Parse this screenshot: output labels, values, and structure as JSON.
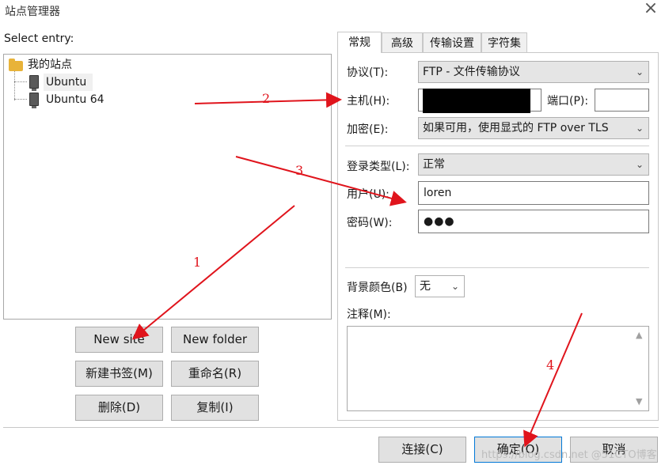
{
  "window": {
    "title": "站点管理器",
    "close_symbol": "×"
  },
  "left": {
    "select_entry_label": "Select entry:",
    "tree": {
      "root": "我的站点",
      "items": [
        "Ubuntu",
        "Ubuntu 64"
      ]
    },
    "buttons": {
      "new_site": "New site",
      "new_folder": "New folder",
      "new_bookmark": "新建书签(M)",
      "rename": "重命名(R)",
      "delete": "删除(D)",
      "copy": "复制(I)"
    }
  },
  "tabs": [
    "常规",
    "高级",
    "传输设置",
    "字符集"
  ],
  "general": {
    "protocol_label": "协议(T):",
    "protocol_value": "FTP - 文件传输协议",
    "host_label": "主机(H):",
    "host_value": "",
    "port_label": "端口(P):",
    "port_value": "",
    "encryption_label": "加密(E):",
    "encryption_value": "如果可用，使用显式的 FTP over TLS",
    "logon_type_label": "登录类型(L):",
    "logon_type_value": "正常",
    "user_label": "用户(U):",
    "user_value": "loren",
    "password_label": "密码(W):",
    "password_value": "●●●",
    "bg_color_label": "背景颜色(B)",
    "bg_color_value": "无",
    "comment_label": "注释(M):"
  },
  "footer": {
    "connect": "连接(C)",
    "ok": "确定(O)",
    "cancel": "取消"
  },
  "annotations": [
    "1",
    "2",
    "3",
    "4"
  ],
  "watermark": "https://blog.csdn.net @51CTO博客",
  "colors": {
    "arrow": "#e0141c",
    "redaction": "#000000"
  }
}
